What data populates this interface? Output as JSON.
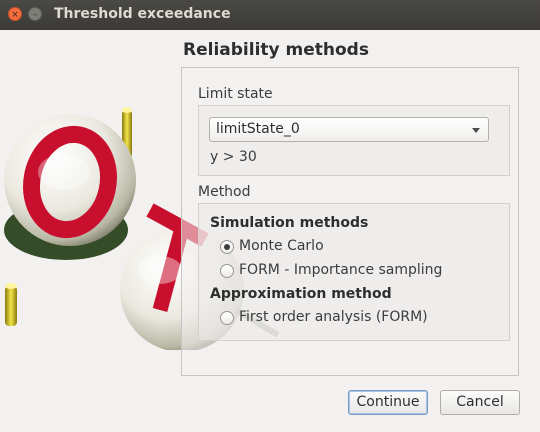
{
  "window": {
    "title": "Threshold exceedance",
    "close_glyph": "×",
    "minimize_glyph": "–"
  },
  "page": {
    "heading": "Reliability methods"
  },
  "limit_state": {
    "label": "Limit state",
    "selected": "limitStateCombo",
    "selected_value": "limitState_0",
    "condition": "y > 30"
  },
  "method": {
    "label": "Method",
    "simulation_heading": "Simulation methods",
    "options": [
      {
        "label": "Monte Carlo",
        "checked": true
      },
      {
        "label": "FORM - Importance sampling",
        "checked": false
      }
    ],
    "approximation_heading": "Approximation method",
    "approximation_options": [
      {
        "label": "First order analysis (FORM)",
        "checked": false
      }
    ]
  },
  "buttons": {
    "continue": "Continue",
    "cancel": "Cancel"
  },
  "colors": {
    "accent": "#f46d3c",
    "logo_red": "#c8102e",
    "logo_gold": "#c9b21a"
  }
}
